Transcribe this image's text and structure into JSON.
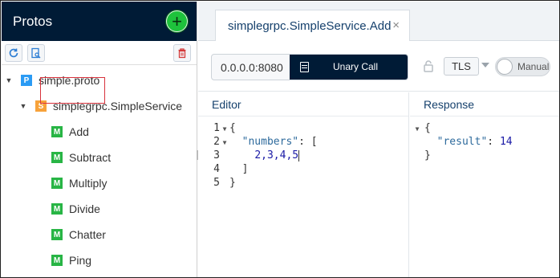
{
  "sidebar": {
    "title": "Protos",
    "add_label": "+",
    "tree": {
      "proto": {
        "badge": "P",
        "label": "simple.proto"
      },
      "service": {
        "badge": "S",
        "label": "simplegrpc.SimpleService"
      },
      "methods": [
        {
          "badge": "M",
          "label": "Add",
          "selected": true
        },
        {
          "badge": "M",
          "label": "Subtract"
        },
        {
          "badge": "M",
          "label": "Multiply"
        },
        {
          "badge": "M",
          "label": "Divide"
        },
        {
          "badge": "M",
          "label": "Chatter"
        },
        {
          "badge": "M",
          "label": "Ping"
        }
      ]
    },
    "tools": [
      "refresh-icon",
      "search-file-icon",
      "trash-icon"
    ]
  },
  "tabs": [
    {
      "label": "simplegrpc.SimpleService.Add",
      "close": "×"
    }
  ],
  "toolbar": {
    "address_value": "0.0.0.0:8080",
    "call_label": "Unary Call",
    "tls_label": "TLS",
    "toggle_label": "Manual"
  },
  "editor": {
    "title": "Editor",
    "lines": [
      {
        "num": "1",
        "fold": true,
        "text": "{"
      },
      {
        "num": "2",
        "fold": true,
        "key": "\"numbers\"",
        "rest": ": ["
      },
      {
        "num": "3",
        "fold": false,
        "nums": "2,3,4,5"
      },
      {
        "num": "4",
        "fold": false,
        "text": "]"
      },
      {
        "num": "5",
        "fold": false,
        "text": "}"
      }
    ]
  },
  "response": {
    "title": "Response",
    "open": "{",
    "key": "\"result\"",
    "sep": ": ",
    "value": "14",
    "close": "}"
  },
  "colors": {
    "header_bg": "#001b36",
    "accent_text": "#15406c",
    "add_button": "#1ec23c",
    "selected_outline": "#d8323c"
  }
}
